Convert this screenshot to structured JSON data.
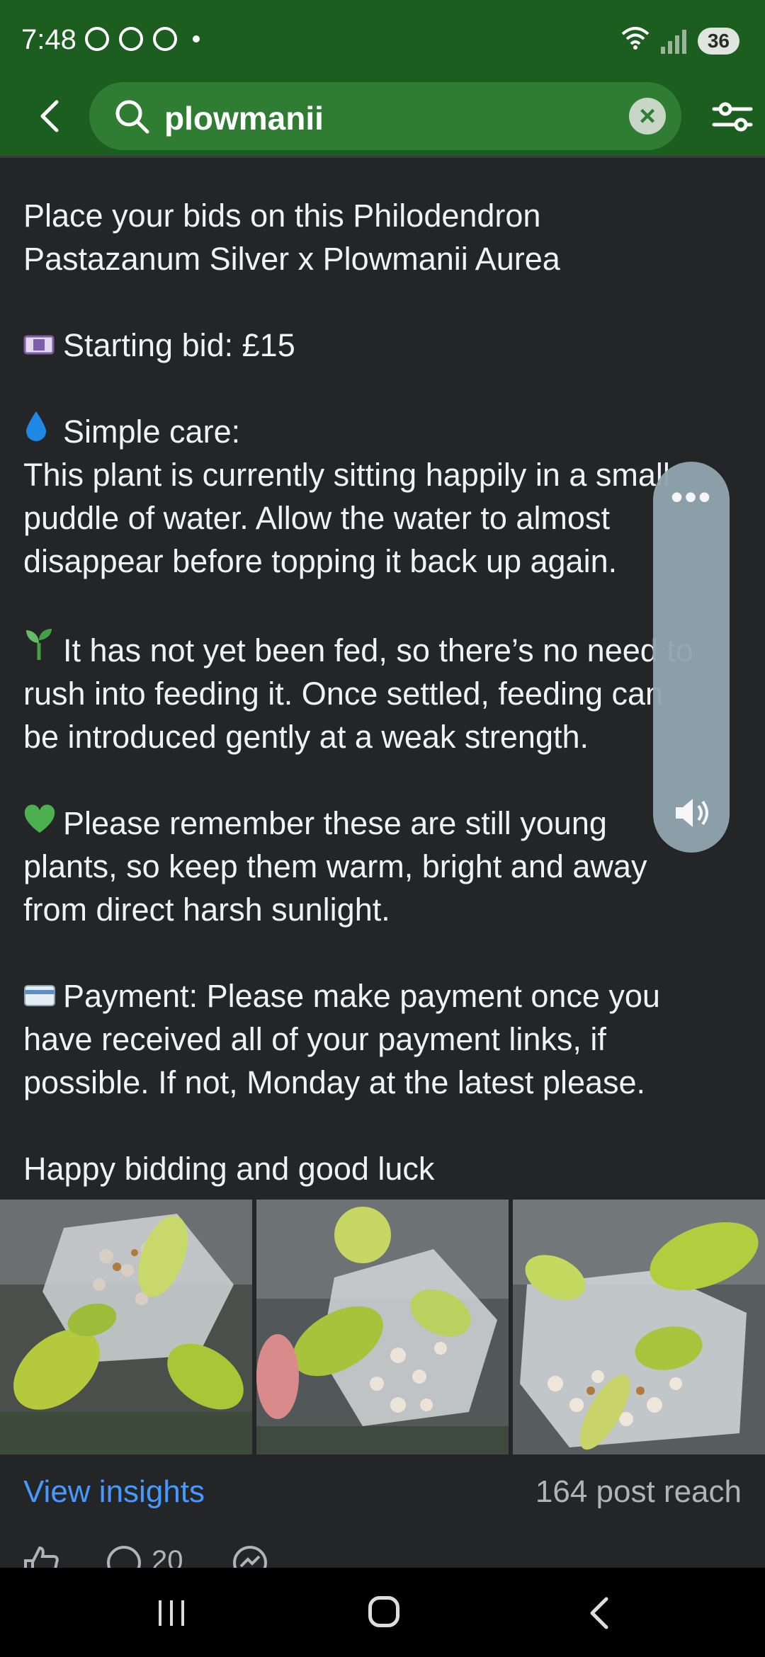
{
  "status_bar": {
    "time": "7:48",
    "battery": "36"
  },
  "search": {
    "query": "plowmanii"
  },
  "post": {
    "line1": "Place your bids on this Philodendron",
    "line2": "Pastazanum Silver x Plowmanii Aurea",
    "bid": "Starting bid: £15",
    "care_title": "Simple care:",
    "care_l1": "This plant is currently sitting happily in a small",
    "care_l2": "puddle of water. Allow the water to almost",
    "care_l3": "disappear before topping it back up again.",
    "feed_l1": "It has not yet been fed, so there’s no need to",
    "feed_l2": "rush into feeding it. Once settled, feeding can",
    "feed_l3": "be introduced gently at a weak strength.",
    "young_l1": "Please remember these are still young",
    "young_l2": "plants, so keep them warm, bright and away",
    "young_l3": "from direct harsh sunlight.",
    "pay_l1": "Payment: Please make payment once you",
    "pay_l2": "have received all of your payment links, if",
    "pay_l3": "possible. If not, Monday at the latest please.",
    "closing": "Happy bidding and good luck"
  },
  "insights": {
    "view_label": "View insights",
    "reach": "164 post reach"
  },
  "actions": {
    "comment_count": "20"
  },
  "icons": {
    "money": "money-bag-icon",
    "droplet": "droplet-icon",
    "seedling": "seedling-icon",
    "heart": "green-heart-icon",
    "card": "credit-card-icon"
  },
  "colors": {
    "brand_green": "#1b5e20",
    "link": "#4599ff",
    "background": "#242526"
  }
}
